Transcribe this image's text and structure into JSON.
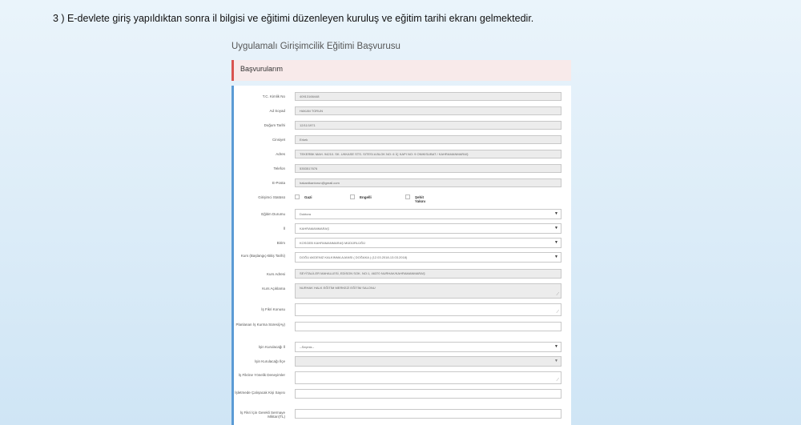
{
  "instruction": "3 )  E-devlete giriş yapıldıktan sonra il bilgisi ve eğitimi düzenleyen kuruluş ve eğitim tarihi ekranı gelmektedir.",
  "app_title": "Uygulamalı Girişimcilik Eğitimi Başvurusu",
  "panel_title": "Başvurularım",
  "form": {
    "tc": {
      "label": "T.C. Kimlik No",
      "value": "40913166448"
    },
    "ad_soyad": {
      "label": "Ad Soyad",
      "value": "HAKAN TORUN"
    },
    "dogum": {
      "label": "Doğum Tarihi",
      "value": "12/11/1971"
    },
    "cinsiyet": {
      "label": "Cinsiyet",
      "value": "Erkek"
    },
    "adres": {
      "label": "Adres",
      "value": "TEKERBK MAH. 94210. SK. UKKASE STS. SITESI A BLOK  NO: 6  İÇ KAPI NO: 9 ONIKISUBAT / KAHRAMANMARAŞ"
    },
    "telefon": {
      "label": "Telefon",
      "value": "5353517676"
    },
    "eposta": {
      "label": "E-Posta",
      "value": "hakantkantorun@gmail.com"
    },
    "statu": {
      "label": "Girişimci Statüsü",
      "options": [
        "Gazi",
        "Engelli",
        "Şehit Yakını"
      ]
    },
    "egitim": {
      "label": "Eğitim Durumu",
      "value": "Doktora"
    },
    "il": {
      "label": "İl",
      "value": "KAHRAMANMARAŞ"
    },
    "birim": {
      "label": "Birim",
      "value": "KOSGEB KAHRAMANMARAŞ MÜDÜRLÜĞÜ"
    },
    "kurs": {
      "label": "Kurs (Başlangıç-Bitiş Tarihi)",
      "value": "DOĞU AKDENIZ KALKINMA AJANSI ( DOĞAKA ) (12.03.2018-13.03.2018)"
    },
    "kurs_adresi": {
      "label": "Kurs Adresi",
      "value": "SEYİTALİLER MAHALLESİ, EDİSON SOK. NO:1, 46370 NURHAK/KAHRAMANMARAŞ"
    },
    "kurs_aciklama": {
      "label": "Kurs Açıklama",
      "value": "NURHAK HALK EĞİTİM MERKEZİ EĞİTİM SALONU"
    },
    "is_fikri": {
      "label": "İş Fikri Konusu",
      "value": ""
    },
    "planlanan": {
      "label": "Planlanan İş Kurma Süresi(Ay)",
      "value": ""
    },
    "isin_il": {
      "label": "İşin Kurulacağı İl",
      "value": "--Seçiniz--"
    },
    "isin_ilce": {
      "label": "İşin Kurulacağı İlçe",
      "value": ""
    },
    "deneyim": {
      "label": "İş Fikrine Yönelik Deneyimler",
      "value": ""
    },
    "calisacak": {
      "label": "İşletmede Çalışacak Kişi Sayısı",
      "value": ""
    },
    "sermaye": {
      "label": "İş Fikri İçin Gerekli Sermaye Miktarı(TL)",
      "value": ""
    }
  },
  "icons": {
    "dropdown": "caret-down-icon",
    "resize": "resize-handle-icon"
  },
  "colors": {
    "header_accent": "#d9534f",
    "form_accent": "#5b9bd5"
  }
}
